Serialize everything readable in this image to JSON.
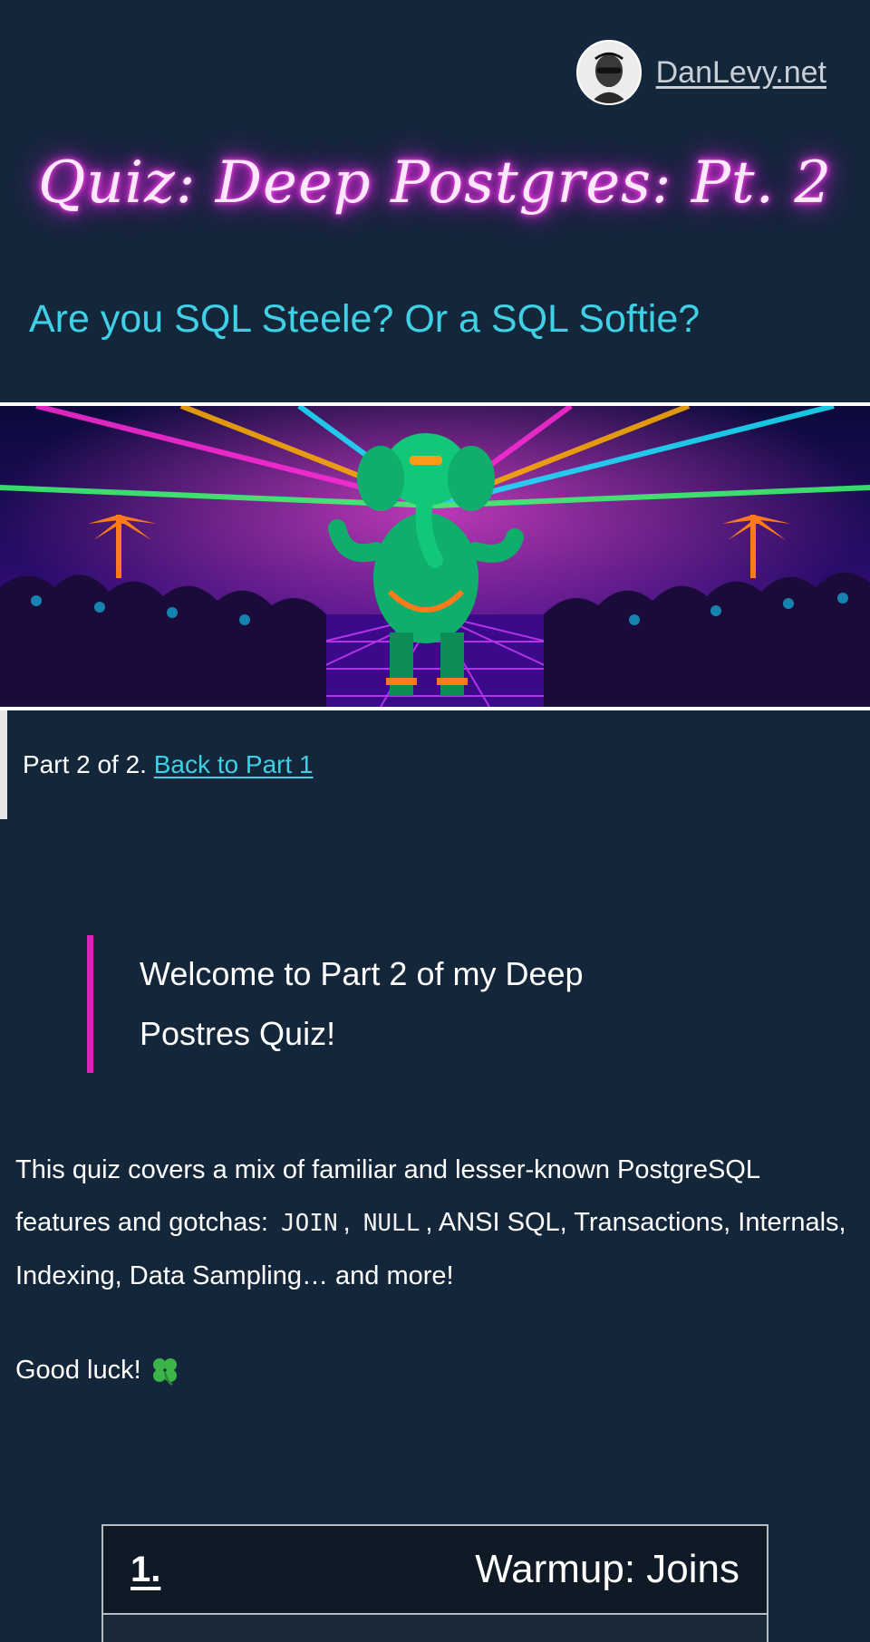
{
  "header": {
    "author_link": "DanLevy.net",
    "title": "Quiz: Deep Postgres: Pt. 2",
    "subtitle": "Are you SQL Steele? Or a SQL Softie?"
  },
  "banner": {
    "image": "neon-elephant-dance-party"
  },
  "part_notice": {
    "text": "Part 2 of 2.",
    "link_text": "Back to Part 1"
  },
  "welcome": {
    "line1": "Welcome to Part 2 of my Deep",
    "line2": "Postres Quiz!"
  },
  "intro": {
    "text_a": "This quiz covers a mix of familiar and lesser-known PostgreSQL features and gotchas: ",
    "code_join": "JOIN",
    "sep": ", ",
    "code_null": "NULL",
    "text_b": ", ANSI SQL, Transactions, Internals, Indexing, Data Sampling… and more!"
  },
  "good_luck": "Good luck!",
  "question": {
    "number": "1.",
    "title": "Warmup: Joins"
  },
  "colors": {
    "background": "#14263a",
    "accent_cyan": "#3fd0e6",
    "accent_magenta": "#e01fb8",
    "neon_title_glow": "#ff2ee8"
  },
  "icons": [
    "avatar",
    "clover-icon"
  ]
}
